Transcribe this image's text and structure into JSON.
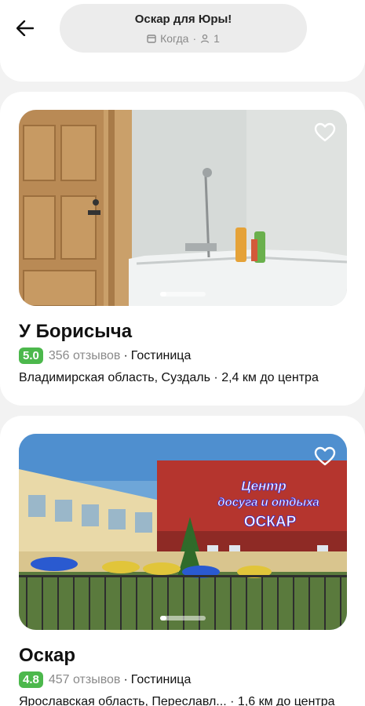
{
  "header": {
    "title": "Оскар для Юры!",
    "when_label": "Когда",
    "separator": "·",
    "guests": "1",
    "back_icon": "arrow-left-icon",
    "calendar_icon": "calendar-icon",
    "person_icon": "person-icon"
  },
  "hotels": [
    {
      "name": "У Борисыча",
      "rating": "5.0",
      "reviews": "356 отзывов",
      "separator": "·",
      "type": "Гостиница",
      "location": "Владимирская область, Суздаль",
      "distance": "2,4 км до центра",
      "favorite_icon": "heart-outline-icon",
      "photo_position": 0.0
    },
    {
      "name": "Оскар",
      "rating": "4.8",
      "reviews": "457 отзывов",
      "separator": "·",
      "type": "Гостиница",
      "location": "Ярославская область, Переславл...",
      "distance": "1,6 км до центра",
      "favorite_icon": "heart-outline-icon",
      "photo_position": 0.0,
      "sign_line1": "Центр",
      "sign_line2": "досуга и отдыха",
      "sign_line3": "ОСКАР"
    }
  ],
  "colors": {
    "rating_bg": "#4cb84c",
    "background": "#f2f2f2",
    "card": "#ffffff"
  }
}
